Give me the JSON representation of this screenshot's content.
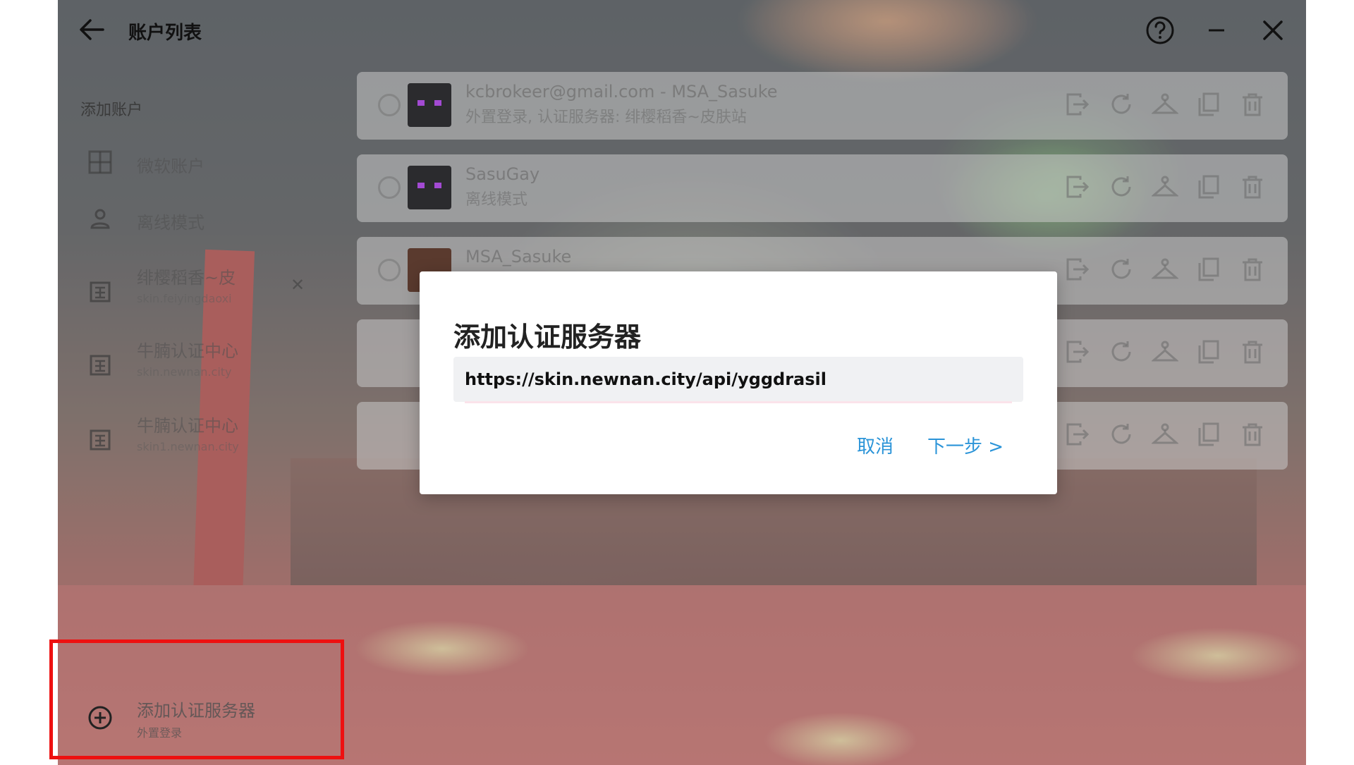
{
  "header": {
    "title": "账户列表"
  },
  "sidebar": {
    "section_label": "添加账户",
    "items": [
      {
        "label": "微软账户",
        "icon": "microsoft-icon"
      },
      {
        "label": "离线模式",
        "icon": "person-icon"
      },
      {
        "label": "绯樱稻香~皮",
        "sublabel": "skin.feiyingdaoxi",
        "icon": "server-icon",
        "removable": true
      },
      {
        "label": "牛腩认证中心",
        "sublabel": "skin.newnan.city",
        "icon": "server-icon"
      },
      {
        "label": "牛腩认证中心",
        "sublabel": "skin1.newnan.city",
        "icon": "server-icon"
      }
    ],
    "add_server": {
      "label": "添加认证服务器",
      "sublabel": "外置登录"
    }
  },
  "accounts": [
    {
      "name": "kcbrokeer@gmail.com - MSA_Sasuke",
      "desc": "外置登录, 认证服务器: 绯樱稻香~皮肤站"
    },
    {
      "name": "SasuGay",
      "desc": "离线模式"
    },
    {
      "name": "MSA_Sasuke",
      "desc": ""
    }
  ],
  "dialog": {
    "title": "添加认证服务器",
    "url_value": "https://skin.newnan.city/api/yggdrasil",
    "cancel_label": "取消",
    "next_label": "下一步 >"
  },
  "colors": {
    "accent": "#2b94d8",
    "highlight": "#ee1010"
  }
}
